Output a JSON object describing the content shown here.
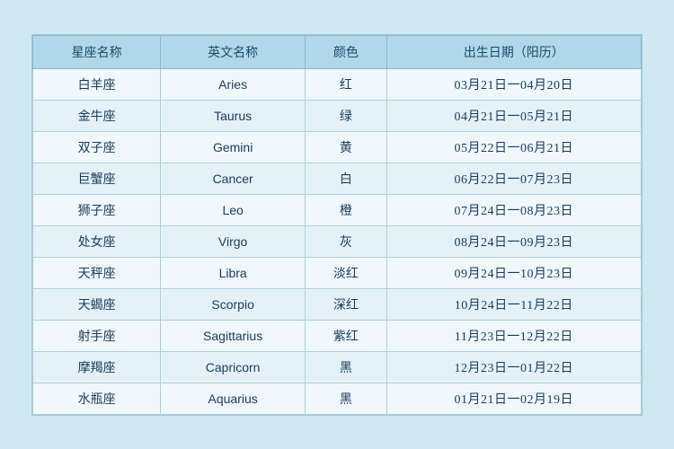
{
  "table": {
    "headers": [
      {
        "key": "chinese_name",
        "label": "星座名称"
      },
      {
        "key": "english_name",
        "label": "英文名称"
      },
      {
        "key": "color",
        "label": "颜色"
      },
      {
        "key": "birthdate",
        "label": "出生日期（阳历）"
      }
    ],
    "rows": [
      {
        "chinese_name": "白羊座",
        "english_name": "Aries",
        "color": "红",
        "birthdate": "03月21日一04月20日"
      },
      {
        "chinese_name": "金牛座",
        "english_name": "Taurus",
        "color": "绿",
        "birthdate": "04月21日一05月21日"
      },
      {
        "chinese_name": "双子座",
        "english_name": "Gemini",
        "color": "黄",
        "birthdate": "05月22日一06月21日"
      },
      {
        "chinese_name": "巨蟹座",
        "english_name": "Cancer",
        "color": "白",
        "birthdate": "06月22日一07月23日"
      },
      {
        "chinese_name": "狮子座",
        "english_name": "Leo",
        "color": "橙",
        "birthdate": "07月24日一08月23日"
      },
      {
        "chinese_name": "处女座",
        "english_name": "Virgo",
        "color": "灰",
        "birthdate": "08月24日一09月23日"
      },
      {
        "chinese_name": "天秤座",
        "english_name": "Libra",
        "color": "淡红",
        "birthdate": "09月24日一10月23日"
      },
      {
        "chinese_name": "天蝎座",
        "english_name": "Scorpio",
        "color": "深红",
        "birthdate": "10月24日一11月22日"
      },
      {
        "chinese_name": "射手座",
        "english_name": "Sagittarius",
        "color": "紫红",
        "birthdate": "11月23日一12月22日"
      },
      {
        "chinese_name": "摩羯座",
        "english_name": "Capricorn",
        "color": "黑",
        "birthdate": "12月23日一01月22日"
      },
      {
        "chinese_name": "水瓶座",
        "english_name": "Aquarius",
        "color": "黑",
        "birthdate": "01月21日一02月19日"
      }
    ]
  }
}
